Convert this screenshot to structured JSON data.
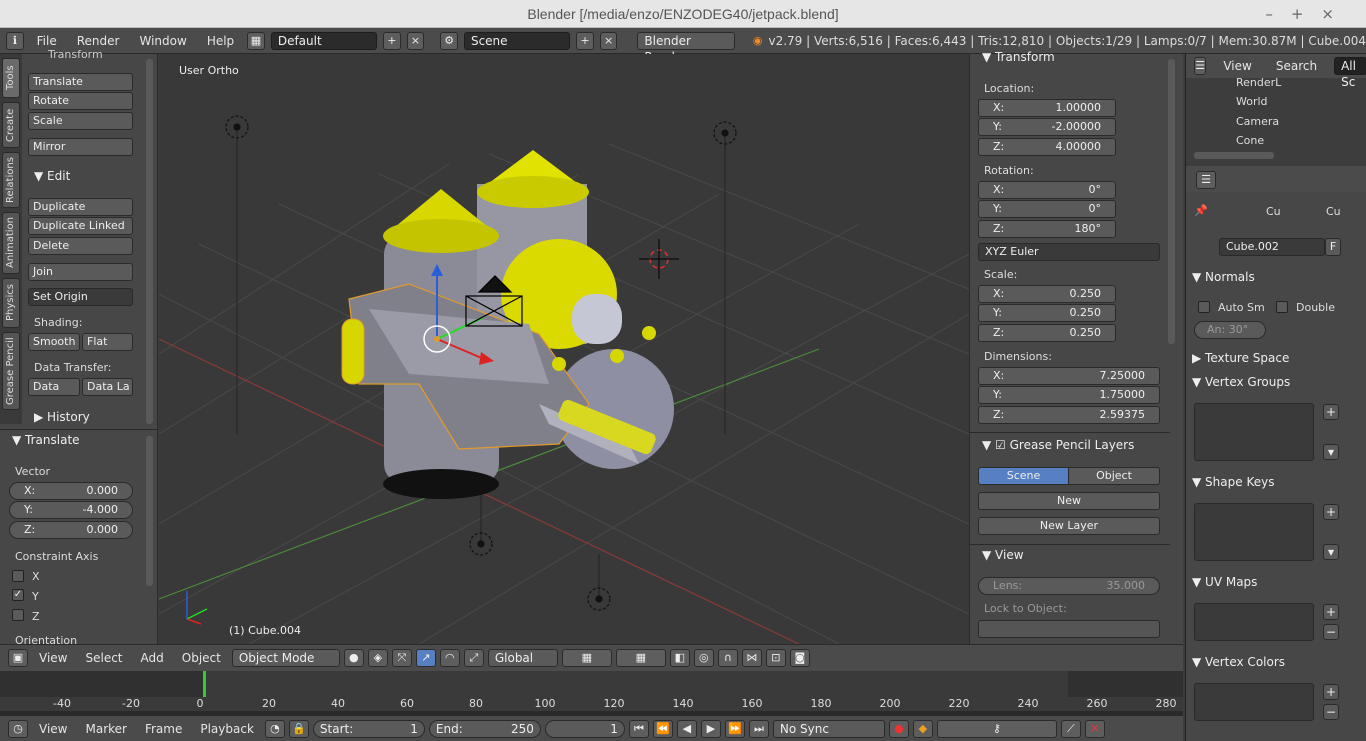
{
  "window": {
    "title": "Blender [/media/enzo/ENZODEG40/jetpack.blend]",
    "controls": [
      "–",
      "+",
      "×"
    ]
  },
  "info": {
    "menus": [
      "File",
      "Render",
      "Window",
      "Help"
    ],
    "layout": "Default",
    "scene": "Scene",
    "engine": "Blender Render",
    "stats": "v2.79 | Verts:6,516 | Faces:6,443 | Tris:12,810 | Objects:1/29 | Lamps:0/7 | Mem:30.87M | Cube.004"
  },
  "tabs": [
    "Tools",
    "Create",
    "Relations",
    "Animation",
    "Physics",
    "Grease Pencil"
  ],
  "tools": {
    "transform_header": "Transform",
    "translate": "Translate",
    "rotate": "Rotate",
    "scale": "Scale",
    "mirror": "Mirror",
    "edit_header": "Edit",
    "duplicate": "Duplicate",
    "duplicate_linked": "Duplicate Linked",
    "delete": "Delete",
    "join": "Join",
    "set_origin": "Set Origin",
    "shading": "Shading:",
    "smooth": "Smooth",
    "flat": "Flat",
    "data_transfer": "Data Transfer:",
    "data": "Data",
    "data_la": "Data La",
    "history": "History"
  },
  "operator": {
    "header": "Translate",
    "vector": "Vector",
    "x_label": "X:",
    "x": "0.000",
    "y_label": "Y:",
    "y": "-4.000",
    "z_label": "Z:",
    "z": "0.000",
    "constraint": "Constraint Axis",
    "cx": "X",
    "cy": "Y",
    "cz": "Z",
    "orientation": "Orientation"
  },
  "viewport": {
    "view_label": "User Ortho",
    "object_label": "(1) Cube.004"
  },
  "npanel": {
    "transform": "Transform",
    "location": "Location:",
    "loc_x": "1.00000",
    "loc_y": "-2.00000",
    "loc_z": "4.00000",
    "rotation": "Rotation:",
    "rot_x": "0°",
    "rot_y": "0°",
    "rot_z": "180°",
    "rot_mode": "XYZ Euler",
    "scale": "Scale:",
    "sc_x": "0.250",
    "sc_y": "0.250",
    "sc_z": "0.250",
    "dimensions": "Dimensions:",
    "dim_x": "7.25000",
    "dim_y": "1.75000",
    "dim_z": "2.59375",
    "lx": "X:",
    "ly": "Y:",
    "lz": "Z:",
    "gp_layers": "Grease Pencil Layers",
    "scene_btn": "Scene",
    "object_btn": "Object",
    "new": "New",
    "new_layer": "New Layer",
    "view": "View",
    "lens": "Lens:",
    "lens_val": "35.000",
    "lock": "Lock to Object:"
  },
  "outliner": {
    "view": "View",
    "search": "Search",
    "all_scenes": "All Sc",
    "items": [
      "RenderL",
      "World",
      "Camera",
      "Cone"
    ]
  },
  "props": {
    "crumb1": "Cu",
    "crumb2": "Cu",
    "mesh_name": "Cube.002",
    "fake": "F",
    "normals": "Normals",
    "auto_smooth": "Auto Sm",
    "double": "Double",
    "angle": "An: 30°",
    "texture_space": "Texture Space",
    "vertex_groups": "Vertex Groups",
    "shape_keys": "Shape Keys",
    "uv_maps": "UV Maps",
    "vertex_colors": "Vertex Colors"
  },
  "vheader": {
    "menus": [
      "View",
      "Select",
      "Add",
      "Object"
    ],
    "mode": "Object Mode",
    "orientation": "Global"
  },
  "timeline": {
    "ticks": [
      "-40",
      "-20",
      "0",
      "20",
      "40",
      "60",
      "80",
      "100",
      "120",
      "140",
      "160",
      "180",
      "200",
      "220",
      "240",
      "260",
      "280"
    ],
    "menus": [
      "View",
      "Marker",
      "Frame",
      "Playback"
    ],
    "start_label": "Start:",
    "start": "1",
    "end_label": "End:",
    "end": "250",
    "current": "1",
    "sync": "No Sync"
  }
}
